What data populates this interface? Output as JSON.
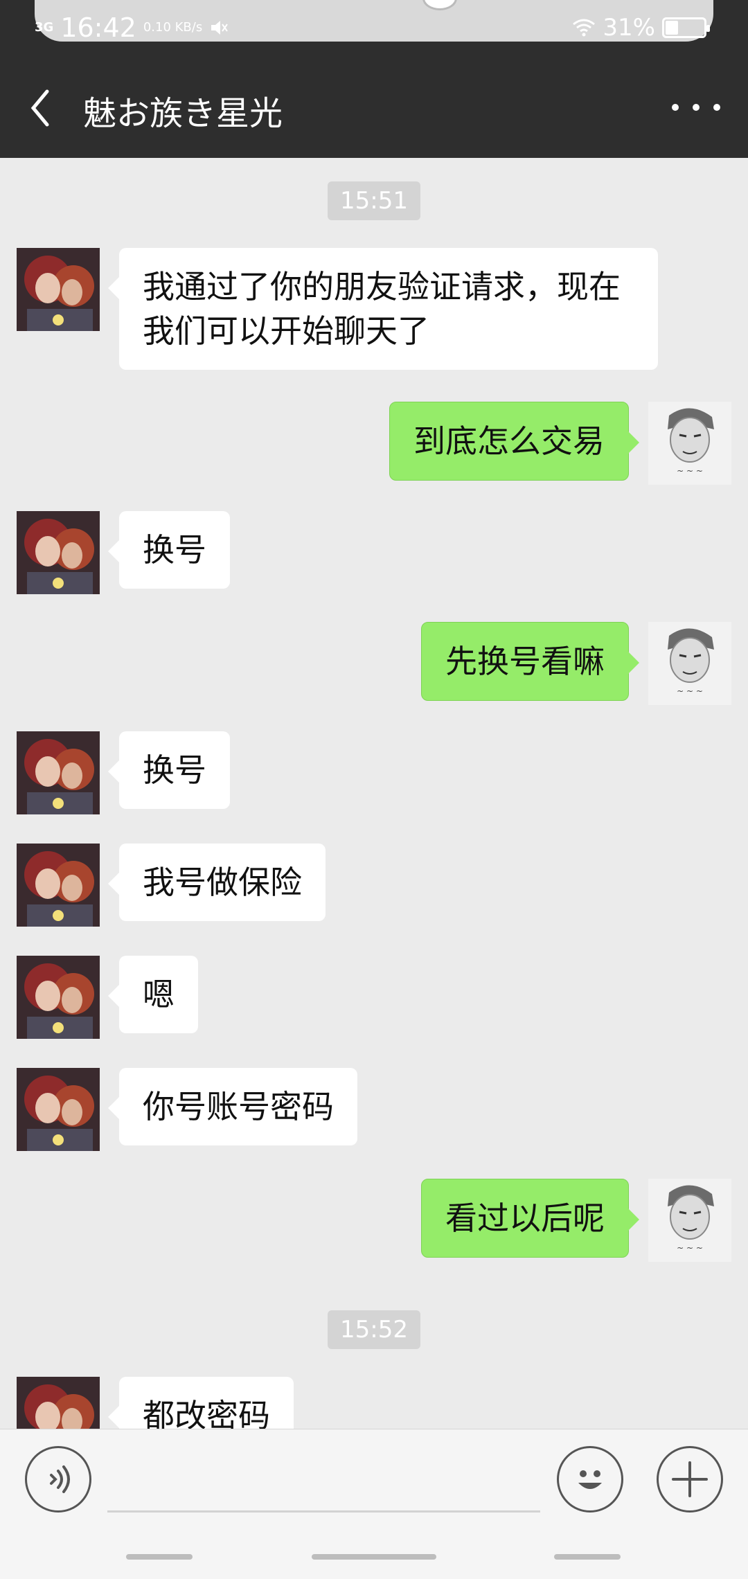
{
  "status_bar": {
    "network": "3G",
    "time": "16:42",
    "speed": "0.10 KB/s",
    "battery": "31%"
  },
  "header": {
    "title": "魅お族き星光",
    "back_icon": "chevron-left-icon",
    "more_icon": "more-horizontal-icon"
  },
  "messages": [
    {
      "type": "time",
      "text": "15:51"
    },
    {
      "type": "in",
      "text": "我通过了你的朋友验证请求，现在我们可以开始聊天了"
    },
    {
      "type": "out",
      "text": "到底怎么交易"
    },
    {
      "type": "in",
      "text": "换号"
    },
    {
      "type": "out",
      "text": "先换号看嘛"
    },
    {
      "type": "in",
      "text": "换号"
    },
    {
      "type": "in",
      "text": "我号做保险"
    },
    {
      "type": "in",
      "text": "嗯"
    },
    {
      "type": "in",
      "text": "你号账号密码"
    },
    {
      "type": "out",
      "text": "看过以后呢"
    },
    {
      "type": "time",
      "text": "15:52"
    },
    {
      "type": "in",
      "text": "都改密码"
    }
  ],
  "input_bar": {
    "voice_icon": "voice-icon",
    "emoji_icon": "emoji-icon",
    "add_icon": "plus-icon",
    "input_value": ""
  },
  "colors": {
    "header_bg": "#2e2e2e",
    "chat_bg": "#ebebeb",
    "outgoing_bubble": "#95ec69",
    "incoming_bubble": "#ffffff"
  }
}
